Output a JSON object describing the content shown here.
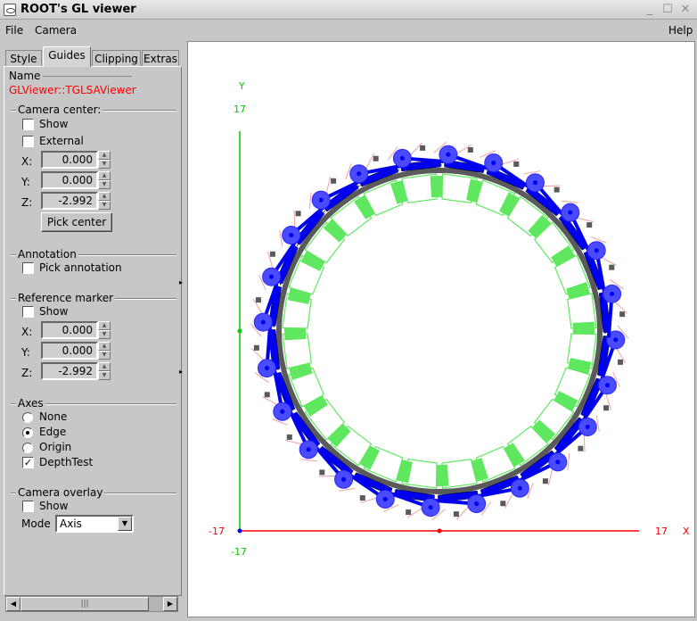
{
  "window": {
    "title": "ROOT's GL viewer",
    "controls": [
      "_",
      "☐",
      "✕"
    ]
  },
  "menubar": {
    "file": "File",
    "camera": "Camera",
    "help": "Help"
  },
  "tabs": [
    {
      "label": "Style",
      "active": false
    },
    {
      "label": "Guides",
      "active": true
    },
    {
      "label": "Clipping",
      "active": false
    },
    {
      "label": "Extras",
      "active": false
    }
  ],
  "name_section": {
    "label": "Name",
    "value": "GLViewer::TGLSAViewer"
  },
  "camera_center": {
    "title": "Camera center:",
    "show_label": "Show",
    "show_checked": false,
    "external_label": "External",
    "external_checked": false,
    "x_label": "X:",
    "x_value": "0.000",
    "y_label": "Y:",
    "y_value": "0.000",
    "z_label": "Z:",
    "z_value": "-2.992",
    "pick_center_label": "Pick center"
  },
  "annotation": {
    "title": "Annotation",
    "pick_label": "Pick annotation",
    "pick_checked": false
  },
  "reference_marker": {
    "title": "Reference marker",
    "show_label": "Show",
    "show_checked": false,
    "x_label": "X:",
    "x_value": "0.000",
    "y_label": "Y:",
    "y_value": "0.000",
    "z_label": "Z:",
    "z_value": "-2.992"
  },
  "axes": {
    "title": "Axes",
    "none_label": "None",
    "edge_label": "Edge",
    "origin_label": "Origin",
    "selected": "Edge",
    "depthtest_label": "DepthTest",
    "depthtest_checked": true
  },
  "camera_overlay": {
    "title": "Camera overlay",
    "show_label": "Show",
    "show_checked": false,
    "mode_label": "Mode",
    "mode_value": "Axis"
  },
  "scroll_thumb": "|||",
  "viewport": {
    "y_axis_label": "Y",
    "y_top_tick": "17",
    "y_bottom_tick": "-17",
    "x_axis_label": "X",
    "x_left_tick": "-17",
    "x_right_tick": "17",
    "module_count": 24,
    "colors": {
      "x_axis": "#ff0000",
      "y_axis": "#00cc00",
      "green": "#5fe85f",
      "blue": "#0000ee",
      "violet": "#4a4aff",
      "gray": "#5a5a5a",
      "pink": "#f0a0a0"
    }
  }
}
